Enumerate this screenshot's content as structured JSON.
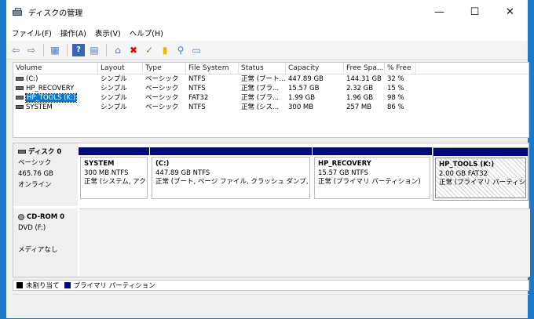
{
  "window": {
    "title": "ディスクの管理",
    "controls": {
      "minimize": "—",
      "maximize": "☐",
      "close": "✕"
    }
  },
  "menu": [
    "ファイル(F)",
    "操作(A)",
    "表示(V)",
    "ヘルプ(H)"
  ],
  "toolbar": {
    "icons": [
      "back-arrow-icon",
      "forward-arrow-icon",
      "disk-view-icon",
      "help-icon",
      "properties-icon",
      "connect-icon",
      "delete-icon",
      "check-icon",
      "new-folder-icon",
      "search-icon",
      "console-icon"
    ],
    "glyphs": [
      "⇦",
      "⇨",
      "▦",
      "?",
      "▤",
      "⌂",
      "✖",
      "✓",
      "▮",
      "⚲",
      "▭"
    ]
  },
  "volume_list": {
    "headers": [
      "Volume",
      "Layout",
      "Type",
      "File System",
      "Status",
      "Capacity",
      "Free Spa...",
      "% Free"
    ],
    "rows": [
      [
        "(C:)",
        "シンプル",
        "ベーシック",
        "NTFS",
        "正常 (ブート...",
        "447.89 GB",
        "144.31 GB",
        "32 %"
      ],
      [
        "HP_RECOVERY",
        "シンプル",
        "ベーシック",
        "NTFS",
        "正常 (プラ...",
        "15.57 GB",
        "2.32 GB",
        "15 %"
      ],
      [
        "HP_TOOLS (K:)",
        "シンプル",
        "ベーシック",
        "FAT32",
        "正常 (プラ...",
        "1.99 GB",
        "1.96 GB",
        "98 %"
      ],
      [
        "SYSTEM",
        "シンプル",
        "ベーシック",
        "NTFS",
        "正常 (シス...",
        "300 MB",
        "257 MB",
        "86 %"
      ]
    ],
    "selected_index": 2
  },
  "disks": [
    {
      "name": "ディスク 0",
      "type": "ベーシック",
      "size": "465.76 GB",
      "status": "オンライン",
      "partitions": [
        {
          "name": "SYSTEM",
          "size": "300 MB NTFS",
          "status": "正常 (システム, アクテ"
        },
        {
          "name": "(C:)",
          "size": "447.89 GB NTFS",
          "status": "正常 (ブート, ページ ファイル, クラッシュ ダンプ, プライマ!"
        },
        {
          "name": "HP_RECOVERY",
          "size": "15.57 GB NTFS",
          "status": "正常 (プライマリ パーティション)"
        },
        {
          "name": "HP_TOOLS  (K:)",
          "size": "2.00 GB FAT32",
          "status": "正常 (プライマリ パーティション)"
        }
      ]
    },
    {
      "name": "CD-ROM 0",
      "type": "DVD (F:)",
      "status": "メディアなし"
    }
  ],
  "legend": [
    {
      "label": "未割り当て",
      "color": "#000000"
    },
    {
      "label": "プライマリ パーティション",
      "color": "#000a7a"
    }
  ]
}
